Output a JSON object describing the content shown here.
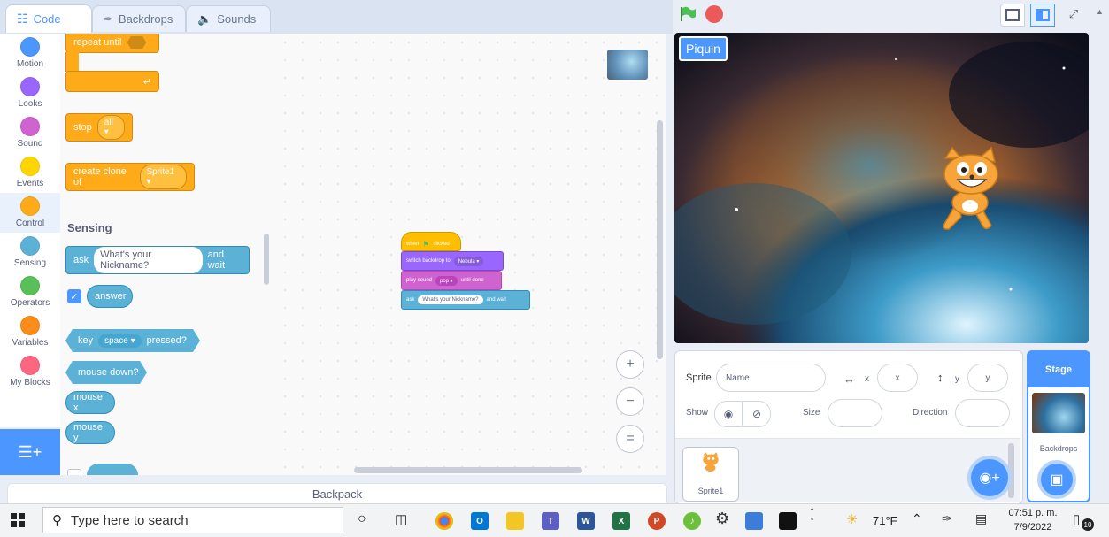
{
  "tabs": {
    "code": "Code",
    "backdrops": "Backdrops",
    "sounds": "Sounds"
  },
  "categories": [
    {
      "label": "Motion",
      "color": "#4c97ff"
    },
    {
      "label": "Looks",
      "color": "#9966ff"
    },
    {
      "label": "Sound",
      "color": "#cf63cf"
    },
    {
      "label": "Events",
      "color": "#ffd500"
    },
    {
      "label": "Control",
      "color": "#ffab19"
    },
    {
      "label": "Sensing",
      "color": "#5cb1d6"
    },
    {
      "label": "Operators",
      "color": "#59c059"
    },
    {
      "label": "Variables",
      "color": "#ff8c1a"
    },
    {
      "label": "My Blocks",
      "color": "#ff6680"
    }
  ],
  "palette": {
    "repeat_until": "repeat until",
    "stop": "stop",
    "stop_option": "all",
    "create_clone": "create clone of",
    "clone_option": "Sprite1",
    "sensing_title": "Sensing",
    "ask": "ask",
    "ask_question": "What's your Nickname?",
    "and_wait": "and wait",
    "answer": "answer",
    "key": "key",
    "key_option": "space",
    "pressed": "pressed?",
    "mouse_down": "mouse down?",
    "mouse_x": "mouse x",
    "mouse_y": "mouse y"
  },
  "script": {
    "when": "when",
    "clicked": "clicked",
    "switch_backdrop": "switch backdrop to",
    "backdrop_option": "Nebula",
    "play_sound": "play sound",
    "sound_option": "pop",
    "until_done": "until done",
    "ask": "ask",
    "question": "What's your Nickname?",
    "and_wait": "and wait"
  },
  "zoom": {
    "in": "+",
    "out": "−",
    "reset": "="
  },
  "backpack": "Backpack",
  "stage": {
    "sprite_label": "Piquin"
  },
  "sprite_info": {
    "sprite_label": "Sprite",
    "name_placeholder": "Name",
    "x_label": "x",
    "x_placeholder": "x",
    "y_label": "y",
    "y_placeholder": "y",
    "show_label": "Show",
    "size_label": "Size",
    "direction_label": "Direction"
  },
  "sprite_list": [
    {
      "name": "Sprite1"
    }
  ],
  "stage_col": {
    "title": "Stage",
    "backdrops": "Backdrops"
  },
  "taskbar": {
    "search_placeholder": "Type here to search",
    "weather": "71°F",
    "time": "07:51 p. m.",
    "date": "7/9/2022",
    "notifications": "10"
  }
}
